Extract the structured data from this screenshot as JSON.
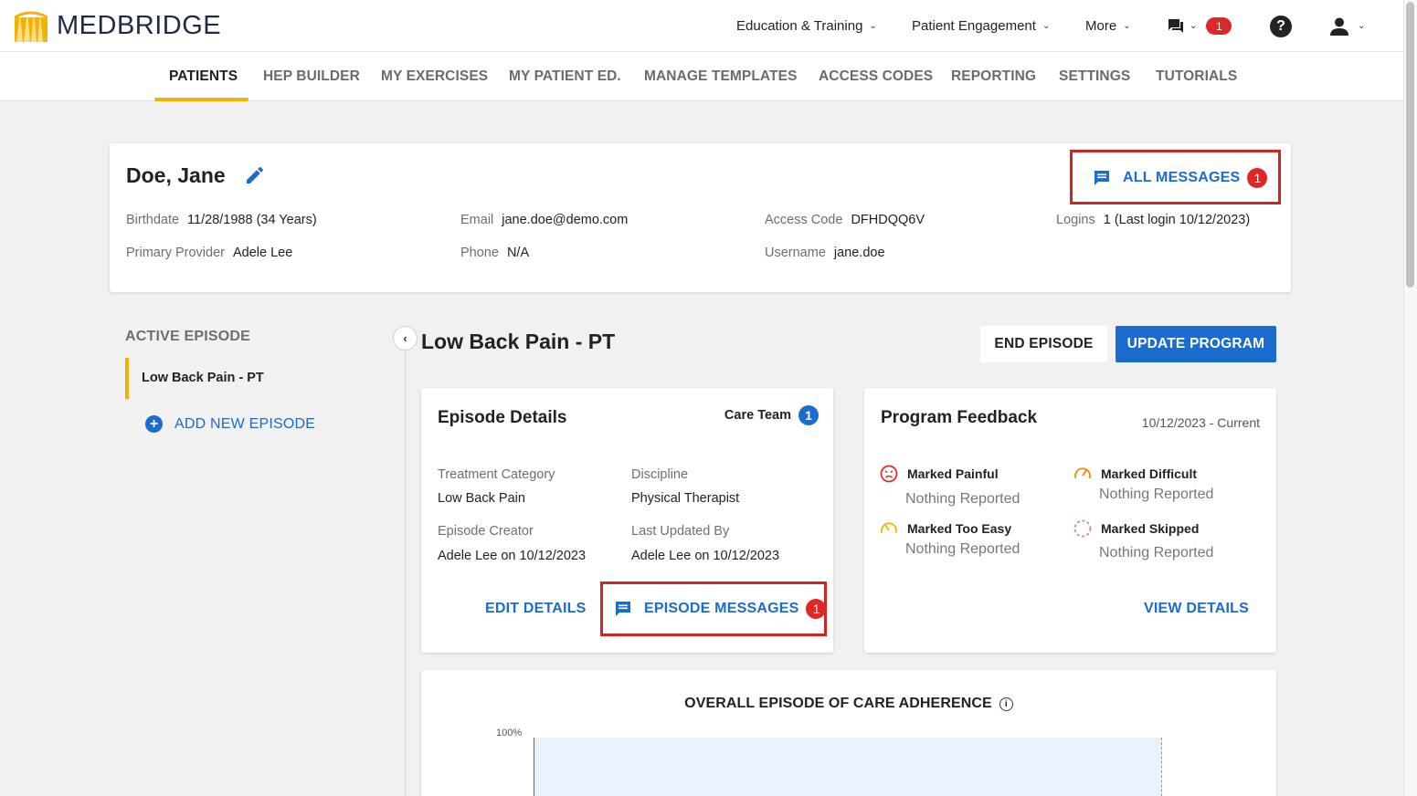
{
  "brand": {
    "name": "MEDBRIDGE",
    "accent": "#f5b301",
    "primary": "#1a6ccf",
    "alert": "#e02727"
  },
  "topnav": {
    "education": "Education & Training",
    "engagement": "Patient Engagement",
    "more": "More",
    "messages_count": "1",
    "help": "?"
  },
  "tabs": [
    {
      "label": "PATIENTS"
    },
    {
      "label": "HEP BUILDER"
    },
    {
      "label": "MY EXERCISES"
    },
    {
      "label": "MY PATIENT ED."
    },
    {
      "label": "MANAGE TEMPLATES"
    },
    {
      "label": "ACCESS CODES"
    },
    {
      "label": "REPORTING"
    },
    {
      "label": "SETTINGS"
    },
    {
      "label": "TUTORIALS"
    }
  ],
  "patient": {
    "name": "Doe, Jane",
    "all_messages_label": "ALL MESSAGES",
    "all_messages_count": "1",
    "birthdate_label": "Birthdate",
    "birthdate": "11/28/1988 (34 Years)",
    "email_label": "Email",
    "email": "jane.doe@demo.com",
    "access_code_label": "Access Code",
    "access_code": "DFHDQQ6V",
    "logins_label": "Logins",
    "logins": "1 (Last login 10/12/2023)",
    "provider_label": "Primary Provider",
    "provider": "Adele Lee",
    "phone_label": "Phone",
    "phone": "N/A",
    "username_label": "Username",
    "username": "jane.doe"
  },
  "sidebar": {
    "active_episode_title": "ACTIVE EPISODE",
    "episode_item": "Low Back Pain - PT",
    "add_new_episode": "ADD NEW EPISODE"
  },
  "episode": {
    "heading": "Low Back Pain - PT",
    "end_episode": "END EPISODE",
    "update_program": "UPDATE PROGRAM"
  },
  "episode_details": {
    "title": "Episode Details",
    "care_team_label": "Care Team",
    "care_team_count": "1",
    "treatment_category_label": "Treatment Category",
    "treatment_category": "Low Back Pain",
    "discipline_label": "Discipline",
    "discipline": "Physical Therapist",
    "creator_label": "Episode Creator",
    "creator": "Adele Lee on 10/12/2023",
    "updated_by_label": "Last Updated By",
    "updated_by": "Adele Lee on 10/12/2023",
    "edit_details": "EDIT DETAILS",
    "episode_messages": "EPISODE MESSAGES",
    "episode_messages_count": "1"
  },
  "feedback": {
    "title": "Program Feedback",
    "date_range": "10/12/2023 - Current",
    "painful_label": "Marked Painful",
    "painful_value": "Nothing Reported",
    "difficult_label": "Marked Difficult",
    "difficult_value": "Nothing Reported",
    "easy_label": "Marked Too Easy",
    "easy_value": "Nothing Reported",
    "skipped_label": "Marked Skipped",
    "skipped_value": "Nothing Reported",
    "view_details": "VIEW DETAILS"
  },
  "adherence": {
    "title": "OVERALL EPISODE OF CARE ADHERENCE",
    "y_tick_top": "100%"
  }
}
